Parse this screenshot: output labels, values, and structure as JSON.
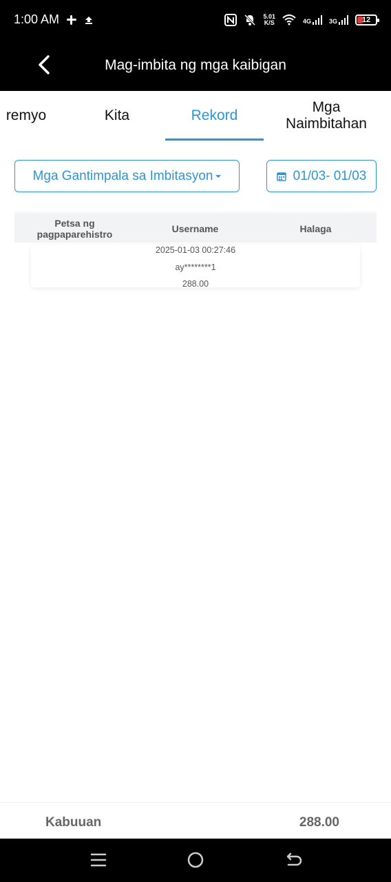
{
  "status_bar": {
    "time": "1:00 AM",
    "net_speed_value": "5.01",
    "net_speed_unit": "K/S",
    "network_1": "4G",
    "network_2": "3G",
    "battery_level": "12"
  },
  "header": {
    "title": "Mag-imbita ng mga kaibigan"
  },
  "tabs": [
    {
      "label": "remyo",
      "active": false
    },
    {
      "label": "Kita",
      "active": false
    },
    {
      "label": "Rekord",
      "active": true
    },
    {
      "label": "Mga Naimbitahan",
      "active": false
    }
  ],
  "filters": {
    "type_label": "Mga Gantimpala sa Imbitasyon",
    "date_range": "01/03- 01/03"
  },
  "table": {
    "columns": [
      "Petsa ng pagpaparehistro",
      "Username",
      "Halaga"
    ],
    "rows": [
      {
        "date": "2025-01-03 00:27:46",
        "username": "ay********1",
        "amount": "288.00"
      }
    ]
  },
  "footer": {
    "total_label": "Kabuuan",
    "total_value": "288.00"
  },
  "colors": {
    "accent": "#2b95d6",
    "battery_low": "#e53935"
  }
}
